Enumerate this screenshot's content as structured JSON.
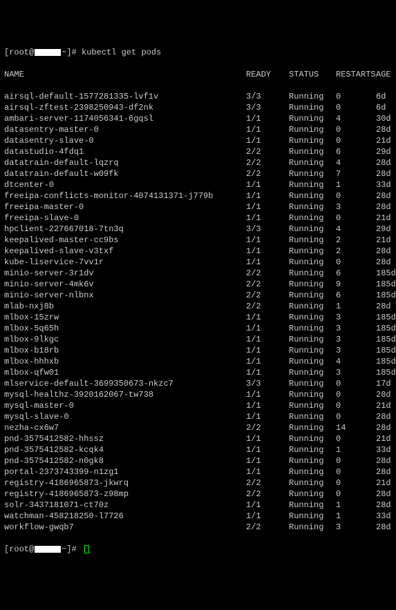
{
  "prompt_prefix": "[root@",
  "prompt_suffix": "~]# ",
  "command": "kubectl get pods",
  "headers": {
    "name": "NAME",
    "ready": "READY",
    "status": "STATUS",
    "restarts": "RESTARTS",
    "age": "AGE"
  },
  "rows": [
    {
      "name": "airsql-default-1577281335-lvf1v",
      "ready": "3/3",
      "status": "Running",
      "restarts": "0",
      "age": "6d"
    },
    {
      "name": "airsql-zftest-2398250943-df2nk",
      "ready": "3/3",
      "status": "Running",
      "restarts": "0",
      "age": "6d"
    },
    {
      "name": "ambari-server-1174056341-6gqsl",
      "ready": "1/1",
      "status": "Running",
      "restarts": "4",
      "age": "30d"
    },
    {
      "name": "datasentry-master-0",
      "ready": "1/1",
      "status": "Running",
      "restarts": "0",
      "age": "28d"
    },
    {
      "name": "datasentry-slave-0",
      "ready": "1/1",
      "status": "Running",
      "restarts": "0",
      "age": "21d"
    },
    {
      "name": "datastudio-4fdq1",
      "ready": "2/2",
      "status": "Running",
      "restarts": "6",
      "age": "29d"
    },
    {
      "name": "datatrain-default-lqzrq",
      "ready": "2/2",
      "status": "Running",
      "restarts": "4",
      "age": "28d"
    },
    {
      "name": "datatrain-default-w09fk",
      "ready": "2/2",
      "status": "Running",
      "restarts": "7",
      "age": "28d"
    },
    {
      "name": "dtcenter-0",
      "ready": "1/1",
      "status": "Running",
      "restarts": "1",
      "age": "33d"
    },
    {
      "name": "freeipa-conflicts-monitor-4074131371-j779b",
      "ready": "1/1",
      "status": "Running",
      "restarts": "0",
      "age": "28d"
    },
    {
      "name": "freeipa-master-0",
      "ready": "1/1",
      "status": "Running",
      "restarts": "3",
      "age": "28d"
    },
    {
      "name": "freeipa-slave-0",
      "ready": "1/1",
      "status": "Running",
      "restarts": "0",
      "age": "21d"
    },
    {
      "name": "hpclient-227667018-7tn3q",
      "ready": "3/3",
      "status": "Running",
      "restarts": "4",
      "age": "29d"
    },
    {
      "name": "keepalived-master-cc9bs",
      "ready": "1/1",
      "status": "Running",
      "restarts": "2",
      "age": "21d"
    },
    {
      "name": "keepalived-slave-v3txf",
      "ready": "1/1",
      "status": "Running",
      "restarts": "2",
      "age": "28d"
    },
    {
      "name": "kube-liservice-7vv1r",
      "ready": "1/1",
      "status": "Running",
      "restarts": "0",
      "age": "28d"
    },
    {
      "name": "minio-server-3r1dv",
      "ready": "2/2",
      "status": "Running",
      "restarts": "6",
      "age": "185d"
    },
    {
      "name": "minio-server-4mk6v",
      "ready": "2/2",
      "status": "Running",
      "restarts": "9",
      "age": "185d"
    },
    {
      "name": "minio-server-nlbnx",
      "ready": "2/2",
      "status": "Running",
      "restarts": "6",
      "age": "185d"
    },
    {
      "name": "mlab-nxj8b",
      "ready": "2/2",
      "status": "Running",
      "restarts": "1",
      "age": "28d"
    },
    {
      "name": "mlbox-15zrw",
      "ready": "1/1",
      "status": "Running",
      "restarts": "3",
      "age": "185d"
    },
    {
      "name": "mlbox-5q65h",
      "ready": "1/1",
      "status": "Running",
      "restarts": "3",
      "age": "185d"
    },
    {
      "name": "mlbox-9lkgc",
      "ready": "1/1",
      "status": "Running",
      "restarts": "3",
      "age": "185d"
    },
    {
      "name": "mlbox-b18rb",
      "ready": "1/1",
      "status": "Running",
      "restarts": "3",
      "age": "185d"
    },
    {
      "name": "mlbox-hhhxb",
      "ready": "1/1",
      "status": "Running",
      "restarts": "4",
      "age": "185d"
    },
    {
      "name": "mlbox-qfw01",
      "ready": "1/1",
      "status": "Running",
      "restarts": "3",
      "age": "185d"
    },
    {
      "name": "mlservice-default-3699350673-nkzc7",
      "ready": "3/3",
      "status": "Running",
      "restarts": "0",
      "age": "17d"
    },
    {
      "name": "mysql-healthz-3920162067-tw738",
      "ready": "1/1",
      "status": "Running",
      "restarts": "0",
      "age": "28d"
    },
    {
      "name": "mysql-master-0",
      "ready": "1/1",
      "status": "Running",
      "restarts": "0",
      "age": "21d"
    },
    {
      "name": "mysql-slave-0",
      "ready": "1/1",
      "status": "Running",
      "restarts": "0",
      "age": "28d"
    },
    {
      "name": "nezha-cx6w7",
      "ready": "2/2",
      "status": "Running",
      "restarts": "14",
      "age": "28d"
    },
    {
      "name": "pnd-3575412582-hhssz",
      "ready": "1/1",
      "status": "Running",
      "restarts": "0",
      "age": "21d"
    },
    {
      "name": "pnd-3575412582-kcqk4",
      "ready": "1/1",
      "status": "Running",
      "restarts": "1",
      "age": "33d"
    },
    {
      "name": "pnd-3575412582-n0gk8",
      "ready": "1/1",
      "status": "Running",
      "restarts": "0",
      "age": "28d"
    },
    {
      "name": "portal-2373743399-n1zg1",
      "ready": "1/1",
      "status": "Running",
      "restarts": "0",
      "age": "28d"
    },
    {
      "name": "registry-4186965873-jkwrq",
      "ready": "2/2",
      "status": "Running",
      "restarts": "0",
      "age": "21d"
    },
    {
      "name": "registry-4186965873-z98mp",
      "ready": "2/2",
      "status": "Running",
      "restarts": "0",
      "age": "28d"
    },
    {
      "name": "solr-3437181071-ct70z",
      "ready": "1/1",
      "status": "Running",
      "restarts": "1",
      "age": "28d"
    },
    {
      "name": "watchman-458218250-l7726",
      "ready": "1/1",
      "status": "Running",
      "restarts": "1",
      "age": "33d"
    },
    {
      "name": "workflow-gwqb7",
      "ready": "2/2",
      "status": "Running",
      "restarts": "3",
      "age": "28d"
    }
  ]
}
